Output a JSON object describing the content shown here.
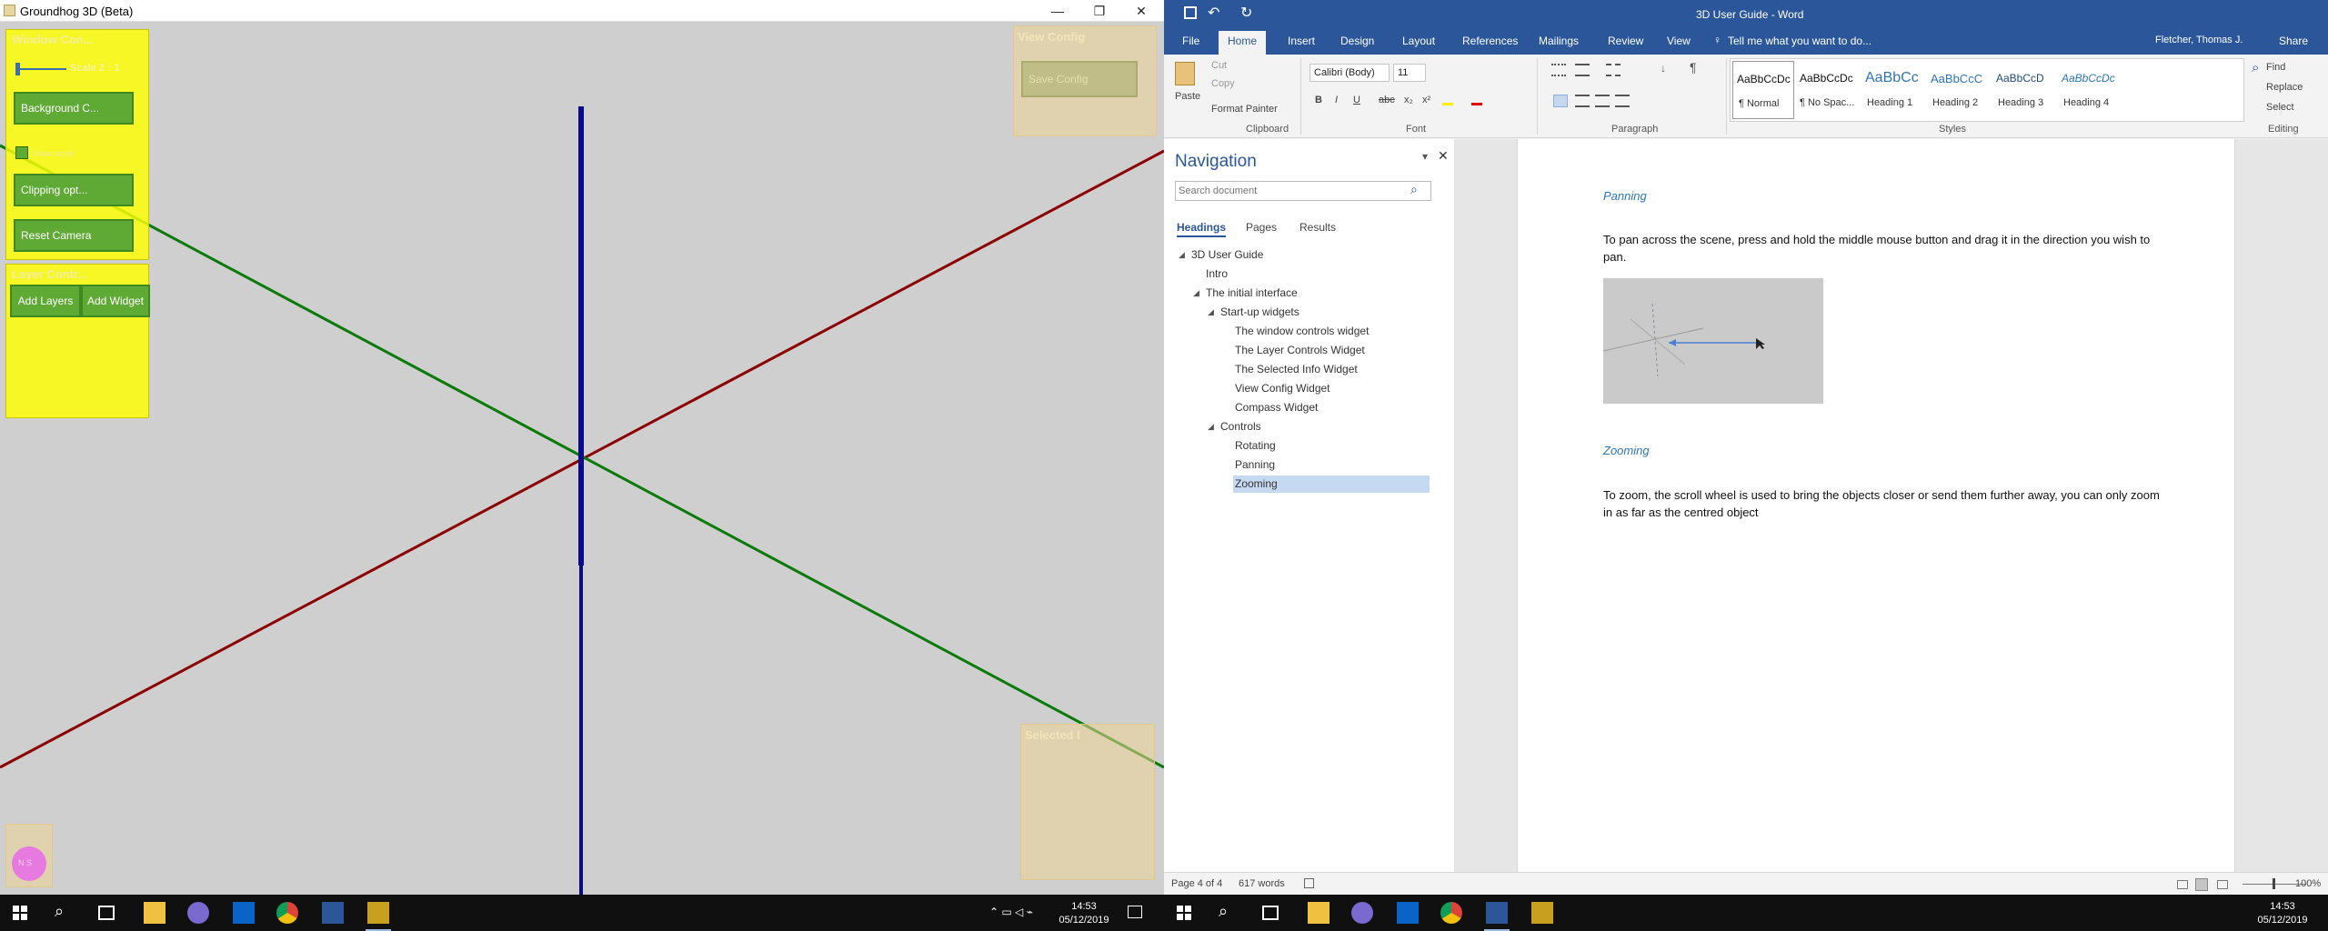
{
  "groundhog": {
    "title": "Groundhog 3D (Beta)",
    "window_controls": {
      "min": "—",
      "max": "❐",
      "close": "✕"
    },
    "window_controls_panel": {
      "title": "Window Con...",
      "scale_label": "Scale Z : 1",
      "background_button": "Background C...",
      "show_scroll_label": "Show scroll",
      "clipping_button": "Clipping opt...",
      "reset_camera_button": "Reset Camera"
    },
    "layer_controls_panel": {
      "title": "Layer Contr...",
      "add_layers_button": "Add Layers",
      "add_widget_button": "Add Widget"
    },
    "view_config_panel": {
      "title": "View Config",
      "save_button": "Save Config"
    },
    "selected_panel": {
      "title": "Selected I"
    },
    "compass_panel": {
      "label": "N S"
    },
    "colors": {
      "x_axis": "#8b0000",
      "y_axis": "#0a7a0a",
      "z_axis": "#0a0a8a",
      "panel": "#ffff00",
      "button": "#5faa35"
    }
  },
  "word": {
    "qat": {
      "save_icon": "save-icon",
      "undo_icon": "undo-icon",
      "redo_icon": "redo-icon"
    },
    "title": "3D User Guide - Word",
    "user": "Fletcher, Thomas J.",
    "share": "Share",
    "tabs": [
      "File",
      "Home",
      "Insert",
      "Design",
      "Layout",
      "References",
      "Mailings",
      "Review",
      "View"
    ],
    "tell_me": "Tell me what you want to do...",
    "clipboard": {
      "paste": "Paste",
      "cut": "Cut",
      "copy": "Copy",
      "format_painter": "Format Painter",
      "group": "Clipboard"
    },
    "font": {
      "name": "Calibri (Body)",
      "size": "11",
      "group": "Font",
      "bold": "B",
      "italic": "I",
      "underline": "U",
      "strike": "abc",
      "sub": "x₂",
      "sup": "x²"
    },
    "paragraph": {
      "group": "Paragraph"
    },
    "styles": {
      "group": "Styles",
      "items": [
        {
          "preview": "AaBbCcDc",
          "name": "¶ Normal"
        },
        {
          "preview": "AaBbCcDc",
          "name": "¶ No Spac..."
        },
        {
          "preview": "AaBbCc",
          "name": "Heading 1"
        },
        {
          "preview": "AaBbCcC",
          "name": "Heading 2"
        },
        {
          "preview": "AaBbCcD",
          "name": "Heading 3"
        },
        {
          "preview": "AaBbCcDc",
          "name": "Heading 4"
        }
      ]
    },
    "editing": {
      "group": "Editing",
      "find": "Find",
      "replace": "Replace",
      "select": "Select"
    },
    "navigation": {
      "title": "Navigation",
      "search_placeholder": "Search document",
      "tabs": [
        "Headings",
        "Pages",
        "Results"
      ],
      "items": [
        {
          "label": "3D User Guide",
          "level": 0
        },
        {
          "label": "Intro",
          "level": 1
        },
        {
          "label": "The initial interface",
          "level": 1
        },
        {
          "label": "Start-up widgets",
          "level": 2
        },
        {
          "label": "The window controls widget",
          "level": 3
        },
        {
          "label": "The Layer Controls Widget",
          "level": 3
        },
        {
          "label": "The Selected Info Widget",
          "level": 3
        },
        {
          "label": "View Config Widget",
          "level": 3
        },
        {
          "label": "Compass Widget",
          "level": 3
        },
        {
          "label": "Controls",
          "level": 2
        },
        {
          "label": "Rotating",
          "level": 3
        },
        {
          "label": "Panning",
          "level": 3
        },
        {
          "label": "Zooming",
          "level": 3,
          "selected": true
        }
      ]
    },
    "document": {
      "heading_panning": "Panning",
      "para_panning": "To pan across the scene, press and hold the middle mouse button and drag it in the direction you wish to pan.",
      "heading_zooming": "Zooming",
      "para_zooming": "To zoom, the scroll wheel is used to bring the objects closer or send them further away, you can only zoom in as far as the centred object"
    },
    "status": {
      "page": "Page 4 of 4",
      "words": "617 words",
      "zoom": "100%"
    }
  },
  "taskbar_left": {
    "time": "14:53",
    "date": "05/12/2019"
  },
  "taskbar_right": {
    "time": "14:53",
    "date": "05/12/2019"
  }
}
